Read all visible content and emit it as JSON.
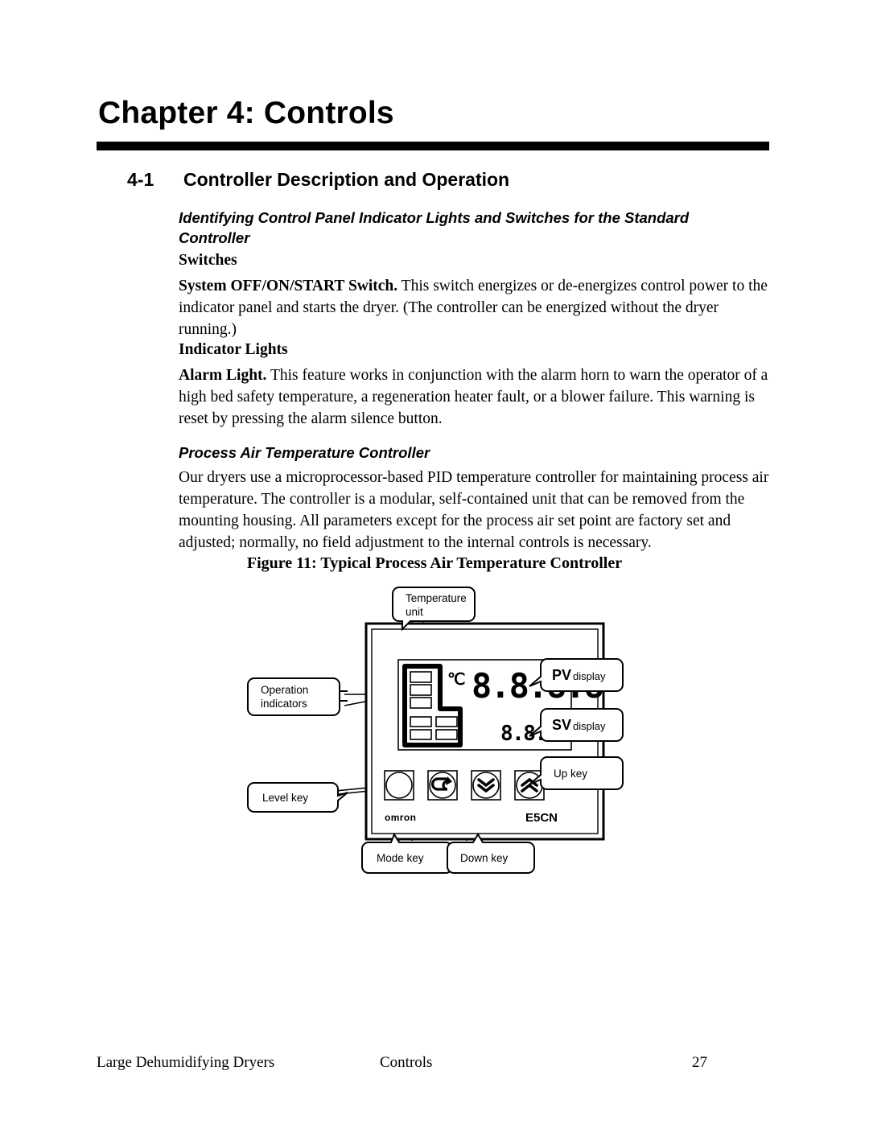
{
  "document": {
    "chapter_title": "Chapter 4: Controls",
    "section": {
      "number": "4-1",
      "title": "Controller Description and Operation"
    },
    "subheading_identifying": "Identifying Control Panel Indicator Lights and Switches for the Standard Controller",
    "heading_switches": "Switches",
    "paragraph_system_switch_bold": "System OFF/ON/START Switch.",
    "paragraph_system_switch_rest": " This switch energizes or de-energizes control power to the indicator panel and starts the dryer.  (The controller can be energized without the dryer running.)",
    "heading_indicator_lights": "Indicator Lights",
    "paragraph_alarm_light_bold": "Alarm Light.",
    "paragraph_alarm_light_rest": "  This feature works in conjunction with the alarm horn to warn the operator of a high bed safety temperature, a regeneration heater fault, or a blower failure.  This warning is reset by pressing the alarm silence button.",
    "subheading_process": "Process Air Temperature Controller",
    "paragraph_process": "Our dryers use a microprocessor-based PID temperature controller for maintaining process air temperature. The controller is a modular, self-contained unit that can be removed from the mounting housing. All parameters except for the process air set point are factory set and adjusted; normally, no field adjustment to the internal controls is necessary.",
    "figure_caption": "Figure 11:  Typical Process Air Temperature Controller"
  },
  "figure": {
    "callouts": {
      "temperature_unit": "Temperature\nunit",
      "temperature_unit_line1": "Temperature",
      "temperature_unit_line2": "unit",
      "operation_indicators_line1": "Operation",
      "operation_indicators_line2": "indicators",
      "level_key": "Level key",
      "mode_key": "Mode key",
      "down_key": "Down key",
      "up_key": "Up key",
      "pv_display_bold": "PV",
      "pv_display_rest": "display",
      "sv_display_bold": "SV",
      "sv_display_rest": "display"
    },
    "panel": {
      "brand": "omron",
      "model": "E5CN",
      "unit_symbol": "℃",
      "pv_value": "8.8.8.8",
      "sv_value": "8.8.8.8"
    },
    "colors": {
      "ink": "#000000",
      "paper": "#ffffff"
    }
  },
  "footer": {
    "left": "Large Dehumidifying Dryers",
    "center": "Controls",
    "right": "27"
  }
}
